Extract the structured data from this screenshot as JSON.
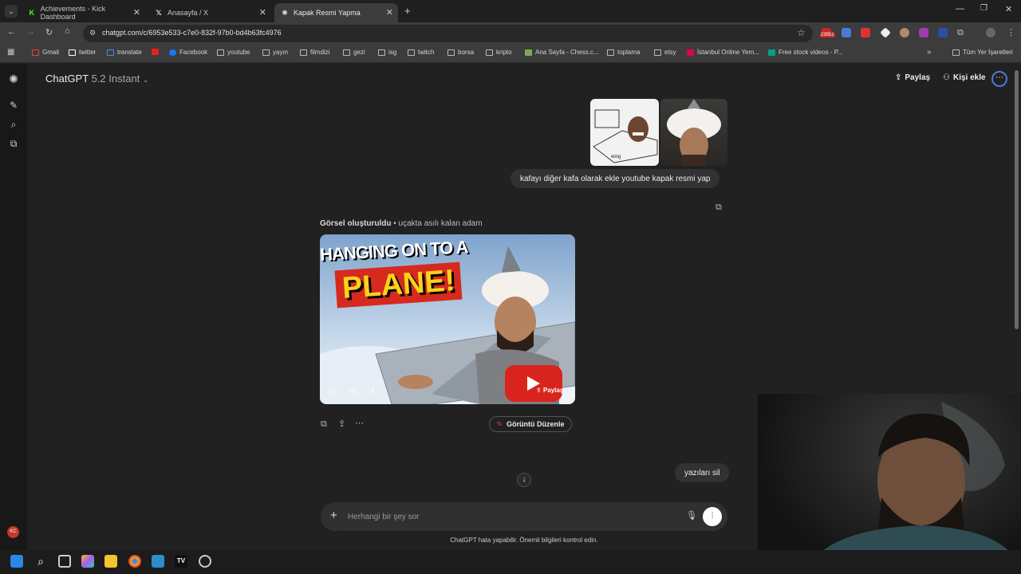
{
  "browser": {
    "tabs": [
      {
        "title": "Achievements - Kick Dashboard",
        "icon": "kick-icon",
        "color": "#53fc18"
      },
      {
        "title": "Anasayfa / X",
        "icon": "x-icon",
        "color": "#ffffff"
      },
      {
        "title": "Kapak Resmi Yapma",
        "icon": "chatgpt-icon",
        "color": "#ffffff"
      }
    ],
    "url": "chatgpt.com/c/6953e533-c7e0-832f-97b0-bd4b63fc4976",
    "extension_badge": "23951",
    "bookmarks": [
      "Gmail",
      "twitter",
      "translate",
      "",
      "Facebook",
      "youtube",
      "yayın",
      "filmdizi",
      "gezi",
      "isg",
      "twitch",
      "borsa",
      "kripto",
      "Ana Sayfa - Chess.c...",
      "toplama",
      "etsy",
      "İstanbul Online Yem...",
      "Free stock videos - P..."
    ],
    "all_bookmarks": "Tüm Yer İşaretleri"
  },
  "header": {
    "model_name": "ChatGPT",
    "model_version": "5.2 Instant",
    "share_label": "Paylaş",
    "add_person_label": "Kişi ekle"
  },
  "chat": {
    "user_msg_1": "kafayı diğer kafa olarak ekle youtube kapak resmi yap",
    "thumb_label": "wing",
    "generated_status": "Görsel oluşturuldu",
    "generated_caption": " • uçakta asılı kalan adam",
    "image_title_1": "HANGING ON TO A",
    "image_title_2": "PLANE!",
    "image_share": "Paylaş",
    "edit_image_label": "Görüntü Düzenle",
    "user_msg_2": "yazıları sil"
  },
  "composer": {
    "placeholder": "Herhangi bir şey sor",
    "disclaimer": "ChatGPT hata yapabilir. Önemli bilgileri kontrol edin."
  },
  "sidebar": {
    "avatar_initials": "KC"
  }
}
